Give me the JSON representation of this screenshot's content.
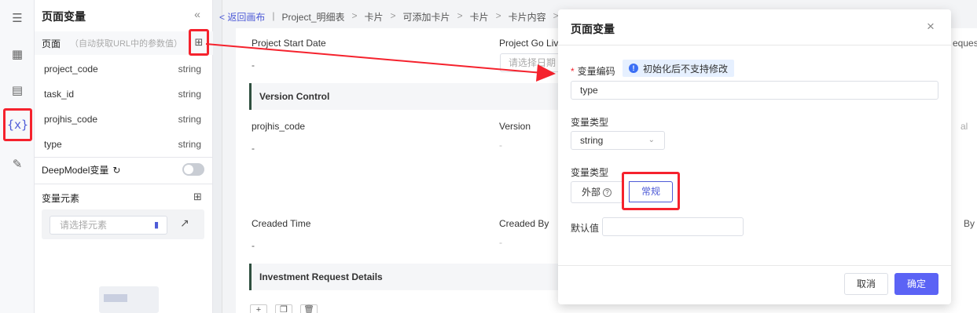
{
  "panel": {
    "title": "页面变量",
    "collapse_icon": "«",
    "page_section": {
      "label": "页面",
      "hint": "（自动获取URL中的参数值）"
    },
    "variables": [
      {
        "name": "project_code",
        "type": "string"
      },
      {
        "name": "task_id",
        "type": "string"
      },
      {
        "name": "projhis_code",
        "type": "string"
      },
      {
        "name": "type",
        "type": "string"
      }
    ],
    "deepmodel_label": "DeepModel变量",
    "element_section": {
      "label": "变量元素",
      "placeholder": "请选择元素"
    }
  },
  "rail": {
    "active_icon_text": "{x}"
  },
  "breadcrumb": {
    "back": "< 返回画布",
    "items": [
      "Project_明细表",
      "卡片",
      "可添加卡片",
      "卡片",
      "卡片内容"
    ]
  },
  "canvas": {
    "project_start_date_label": "Project Start Date",
    "project_go_live_label": "Project Go Live",
    "date_placeholder": "请选择日期",
    "dash": "-",
    "version_control_title": "Version Control",
    "projhis_code_label": "projhis_code",
    "version_label": "Version",
    "created_time_label": "Creaded Time",
    "created_by_label": "Creaded By",
    "investment_title": "Investment Request Details",
    "right_clip_1": "equest",
    "right_clip_2": "al",
    "right_clip_3": "By"
  },
  "modal": {
    "title": "页面变量",
    "close": "×",
    "code_label": "变量编码",
    "code_notice": "初始化后不支持修改",
    "code_value": "type",
    "type_label": "变量类型",
    "type_value": "string",
    "kind_label": "变量类型",
    "kind_external": "外部",
    "kind_normal": "常规",
    "default_label": "默认值",
    "cancel": "取消",
    "confirm": "确定"
  },
  "colors": {
    "accent": "#5b63f5",
    "highlight": "#f5222d"
  }
}
